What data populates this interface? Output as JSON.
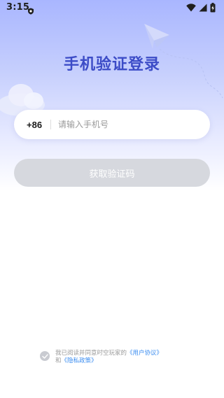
{
  "status_bar": {
    "time": "3:15",
    "left_icons": [
      "shield-icon"
    ],
    "right_icons": [
      "wifi-icon",
      "cellular-signal-icon",
      "battery-charging-icon"
    ]
  },
  "page": {
    "title": "手机验证登录"
  },
  "phone_form": {
    "country_code": "+86",
    "input_value": "",
    "input_placeholder": "请输入手机号"
  },
  "get_code_button": {
    "label": "获取验证码",
    "enabled": false
  },
  "agreement": {
    "checked": false,
    "prefix_text": "我已阅读并同意时空玩家的",
    "user_agreement_link": "《用户协议》",
    "conjunction": "和",
    "privacy_policy_link": "《隐私政策》"
  },
  "colors": {
    "title": "#3c4cc7",
    "button_disabled": "#d6d8de",
    "link": "#3a8cf0",
    "gradient_top": "#a9b6ff"
  }
}
